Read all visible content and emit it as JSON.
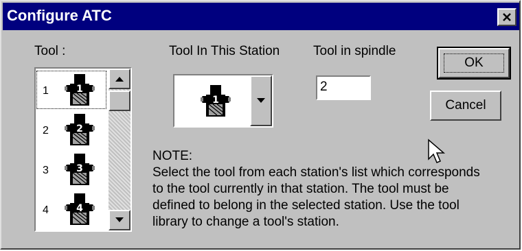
{
  "window": {
    "title": "Configure ATC",
    "close_glyph": "✕"
  },
  "tool_list": {
    "label": "Tool :",
    "items": [
      {
        "number": "1",
        "icon_label": "1",
        "selected": true
      },
      {
        "number": "2",
        "icon_label": "2",
        "selected": false
      },
      {
        "number": "3",
        "icon_label": "3",
        "selected": false
      },
      {
        "number": "4",
        "icon_label": "4",
        "selected": false
      }
    ]
  },
  "station": {
    "label": "Tool In This Station",
    "selected_icon_label": "1"
  },
  "spindle": {
    "label": "Tool in spindle",
    "value": "2"
  },
  "buttons": {
    "ok": "OK",
    "cancel": "Cancel"
  },
  "note": {
    "heading": "NOTE:",
    "lines": [
      "Select the tool from each station's list which corresponds",
      "to the tool currently in that station.  The tool must be",
      "defined to belong in the selected station.   Use the tool",
      "library to change a tool's station."
    ]
  },
  "colors": {
    "titlebar": "#00007f",
    "face": "#c0c0c0"
  },
  "icons": {
    "tool": "tool-holder-icon",
    "scroll_up": "arrow-up-icon",
    "scroll_down": "arrow-down-icon",
    "dropdown": "chevron-down-icon",
    "cursor": "mouse-pointer-icon"
  }
}
